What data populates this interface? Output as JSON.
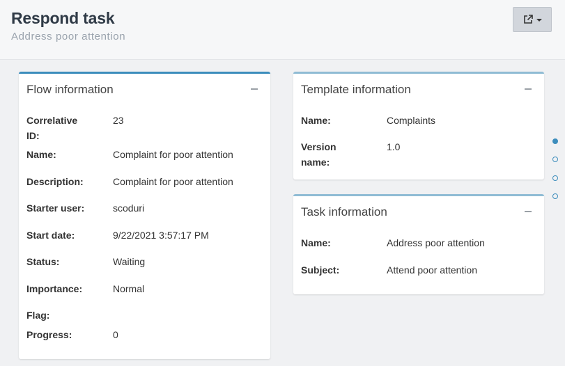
{
  "header": {
    "title": "Respond task",
    "subtitle": "Address poor attention"
  },
  "action_button": {
    "icon": "external-link-icon"
  },
  "flow_panel": {
    "title": "Flow information",
    "fields": [
      {
        "label": "Correlative ID:",
        "value": "23"
      },
      {
        "label": "Name:",
        "value": "Complaint for poor attention"
      },
      {
        "label": "Description:",
        "value": "Complaint for poor attention"
      },
      {
        "label": "Starter user:",
        "value": "scoduri"
      },
      {
        "label": "Start date:",
        "value": "9/22/2021 3:57:17 PM"
      },
      {
        "label": "Status:",
        "value": "Waiting"
      },
      {
        "label": "Importance:",
        "value": "Normal"
      },
      {
        "label": "Flag:",
        "value": ""
      },
      {
        "label": "Progress:",
        "value": "0"
      }
    ]
  },
  "template_panel": {
    "title": "Template information",
    "fields": [
      {
        "label": "Name:",
        "value": "Complaints"
      },
      {
        "label": "Version name:",
        "value": "1.0"
      }
    ]
  },
  "task_panel": {
    "title": "Task information",
    "fields": [
      {
        "label": "Name:",
        "value": "Address poor attention"
      },
      {
        "label": "Subject:",
        "value": "Attend poor attention"
      }
    ]
  },
  "colors": {
    "accent": "#3c8dbc",
    "accent_light": "#8fbcd4",
    "title": "#2f3a46",
    "subtitle": "#9aa3ad"
  }
}
